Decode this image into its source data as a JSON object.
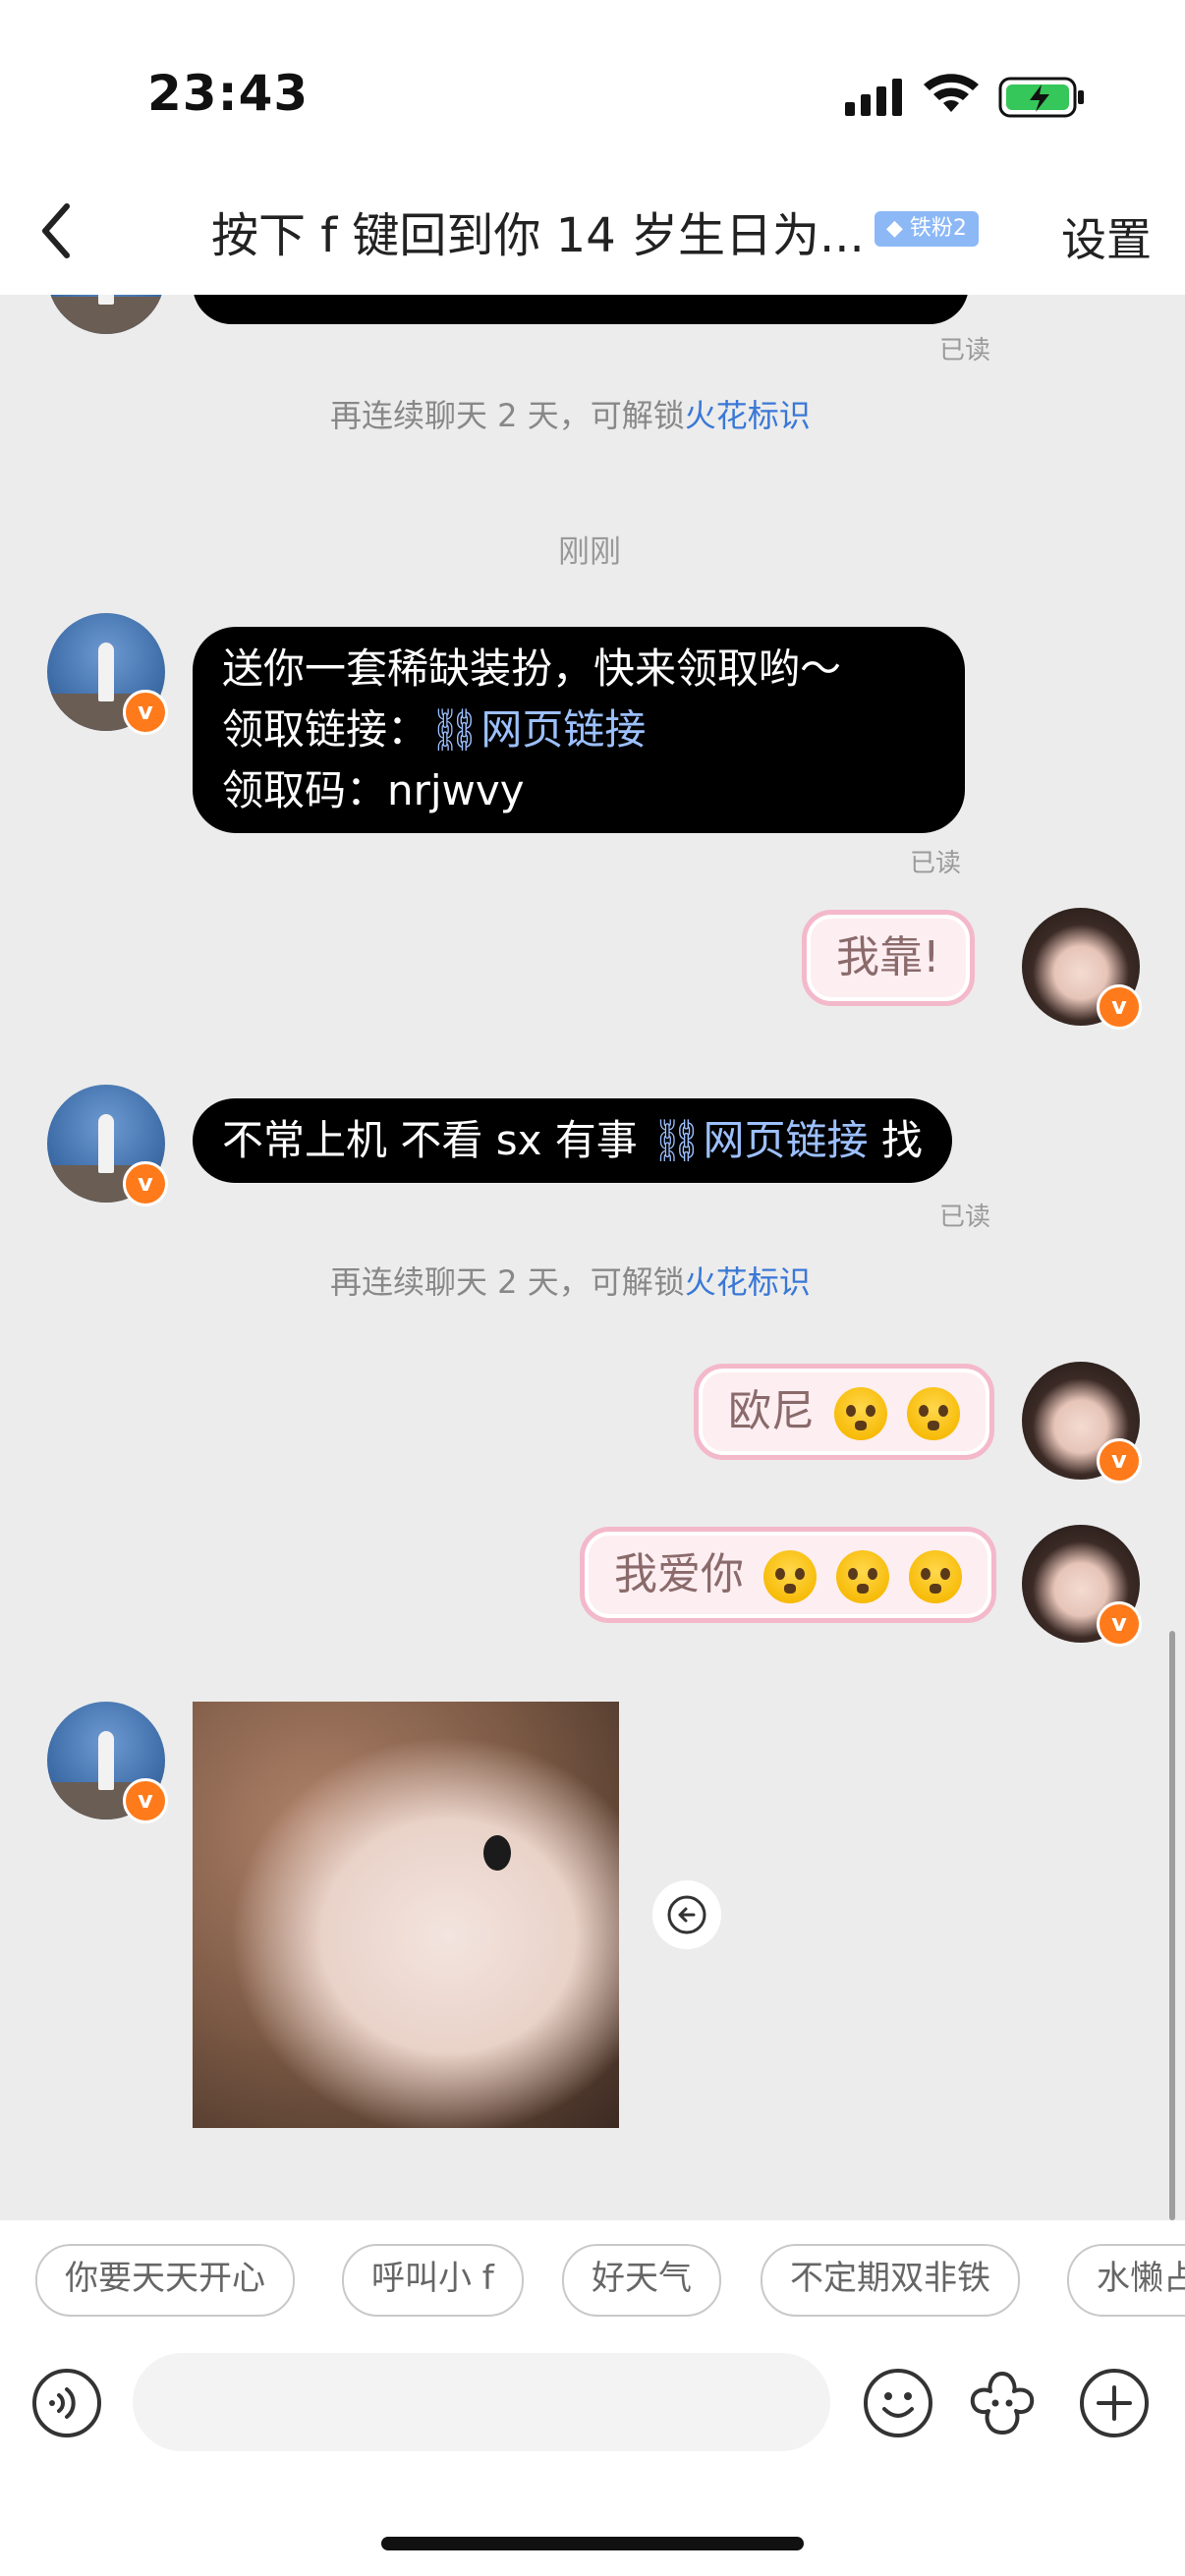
{
  "status_bar": {
    "time": "23:43"
  },
  "header": {
    "title": "按下 f 键回到你 14 岁生日为...",
    "badge": "铁粉2",
    "settings": "设置"
  },
  "chat": {
    "read_label": "已读",
    "system_msg": {
      "prefix": "再连续聊天 2 天，可解锁",
      "highlight": "火花标识"
    },
    "timestamp": "刚刚",
    "msg1": {
      "line1": "送你一套稀缺装扮，快来领取哟～",
      "line2_label": "领取链接：",
      "link_text": "网页链接",
      "line3": "领取码：nrjwvy"
    },
    "msg2": "我靠!",
    "msg3": {
      "text1": "不常上机 不看 sx 有事",
      "link_text": "网页链接",
      "text2": "找"
    },
    "msg4": "欧尼",
    "msg5": "我爱你"
  },
  "quick_replies": [
    "你要天天开心",
    "呼叫小 f",
    "好天气",
    "不定期双非铁",
    "水懒占"
  ],
  "toolbar": {
    "voice_icon": "voice-icon",
    "emoji_icon": "emoji-icon",
    "sticker_icon": "flower-icon",
    "plus_icon": "plus-icon"
  }
}
